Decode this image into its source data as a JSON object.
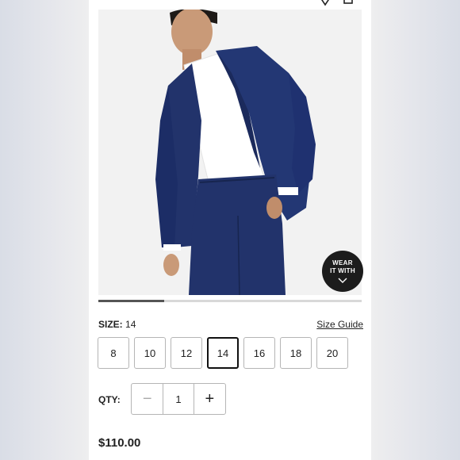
{
  "product": {
    "image_alt": "Boy wearing navy blue suit",
    "wear_it_with": {
      "line1": "WEAR",
      "line2": "IT WITH"
    },
    "carousel_progress": 0.25
  },
  "size": {
    "label": "SIZE:",
    "selected": "14",
    "guide_label": "Size Guide",
    "options": [
      "8",
      "10",
      "12",
      "14",
      "16",
      "18",
      "20"
    ]
  },
  "quantity": {
    "label": "QTY:",
    "value": "1",
    "minus": "−",
    "plus": "+"
  },
  "price": "$110.00",
  "icons": {
    "favorite": "heart-icon",
    "bag": "shopping-bag-icon",
    "expand": "chevron-down-icon"
  },
  "colors": {
    "suit": "#22336b",
    "selected_border": "#111111",
    "wear_button": "#1c1c1c"
  }
}
